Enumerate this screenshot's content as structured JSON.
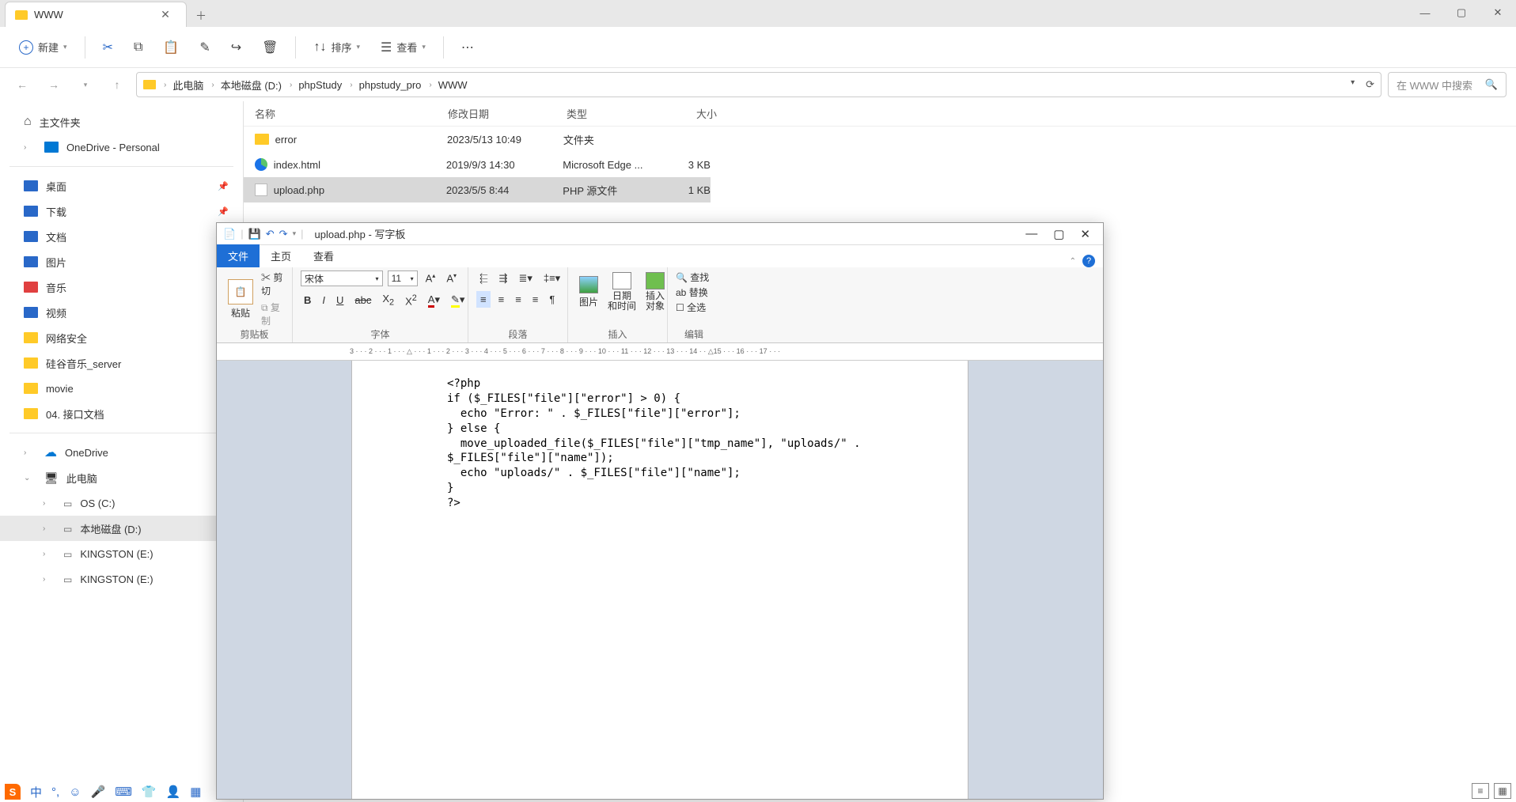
{
  "explorer": {
    "tab_title": "WWW",
    "toolbar": {
      "new": "新建",
      "sort": "排序",
      "view": "查看"
    },
    "breadcrumb": [
      "此电脑",
      "本地磁盘 (D:)",
      "phpStudy",
      "phpstudy_pro",
      "WWW"
    ],
    "search_placeholder": "在 WWW 中搜索",
    "columns": {
      "name": "名称",
      "date": "修改日期",
      "type": "类型",
      "size": "大小"
    },
    "rows": [
      {
        "name": "error",
        "date": "2023/5/13 10:49",
        "type": "文件夹",
        "size": "",
        "icon": "folder"
      },
      {
        "name": "index.html",
        "date": "2019/9/3 14:30",
        "type": "Microsoft Edge ...",
        "size": "3 KB",
        "icon": "edge"
      },
      {
        "name": "upload.php",
        "date": "2023/5/5 8:44",
        "type": "PHP 源文件",
        "size": "1 KB",
        "icon": "php",
        "selected": true
      }
    ],
    "sidebar": {
      "home": "主文件夹",
      "onedrive_personal": "OneDrive - Personal",
      "quick": [
        {
          "label": "桌面",
          "icon": "blue"
        },
        {
          "label": "下载",
          "icon": "blue"
        },
        {
          "label": "文档",
          "icon": "blue"
        },
        {
          "label": "图片",
          "icon": "blue"
        },
        {
          "label": "音乐",
          "icon": "red"
        },
        {
          "label": "视频",
          "icon": "blue"
        }
      ],
      "pinned": [
        "网络安全",
        "硅谷音乐_server",
        "movie",
        "04. 接口文档"
      ],
      "onedrive": "OneDrive",
      "thispc": "此电脑",
      "drives": [
        "OS (C:)",
        "本地磁盘 (D:)",
        "KINGSTON (E:)",
        "KINGSTON (E:)"
      ],
      "selected_drive": "本地磁盘 (D:)"
    }
  },
  "wordpad": {
    "title": "upload.php - 写字板",
    "tabs": {
      "file": "文件",
      "home": "主页",
      "view": "查看"
    },
    "clipboard": {
      "paste": "粘贴",
      "cut": "剪切",
      "copy": "复制",
      "group": "剪贴板"
    },
    "font": {
      "name": "宋体",
      "size": "11",
      "group": "字体"
    },
    "para": {
      "group": "段落"
    },
    "insert": {
      "picture": "图片",
      "datetime": "日期\n和时间",
      "object": "插入\n对象",
      "group": "插入"
    },
    "edit": {
      "find": "查找",
      "replace": "替换",
      "selectall": "全选",
      "group": "编辑"
    },
    "ruler": "3 · · · 2 · · · 1 · · · △ · · · 1 · · · 2 · · · 3 · · · 4 · · · 5 · · · 6 · · · 7 · · · 8 · · · 9 · · · 10 · · · 11 · · · 12 · · · 13 · · · 14 · · △15 · · · 16 · · · 17 · · ·",
    "code": "<?php\nif ($_FILES[\"file\"][\"error\"] > 0) {\n  echo \"Error: \" . $_FILES[\"file\"][\"error\"];\n} else {\n  move_uploaded_file($_FILES[\"file\"][\"tmp_name\"], \"uploads/\" . \n$_FILES[\"file\"][\"name\"]);\n  echo \"uploads/\" . $_FILES[\"file\"][\"name\"];\n}\n?>"
  },
  "ime": {
    "label": "中"
  }
}
